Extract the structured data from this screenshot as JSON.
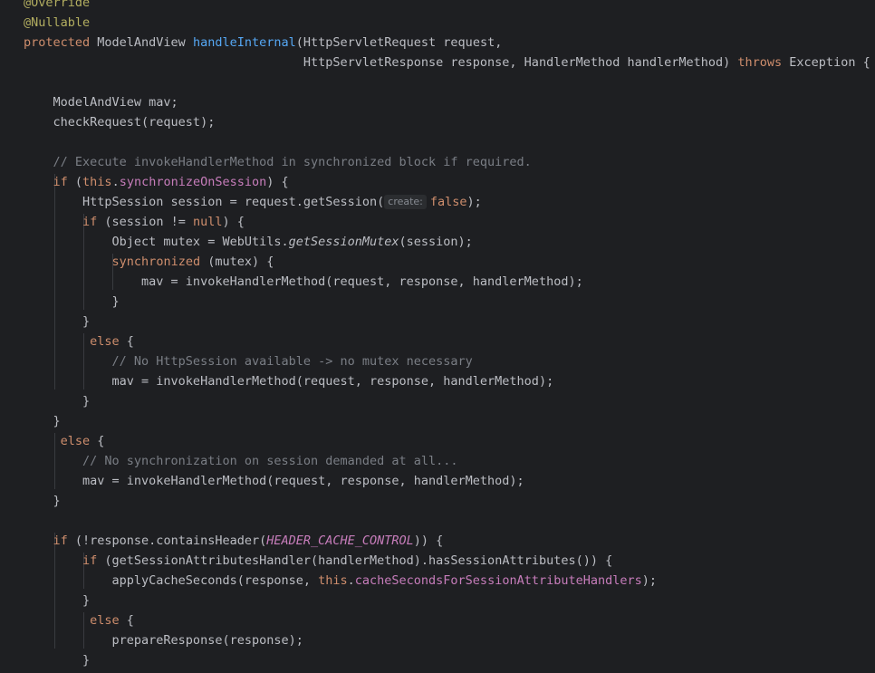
{
  "editor": {
    "lines": [
      [
        {
          "t": "@Override",
          "c": "ann"
        }
      ],
      [
        {
          "t": "@Nullable",
          "c": "ann"
        }
      ],
      [
        {
          "t": "protected ",
          "c": "kw"
        },
        {
          "t": "ModelAndView "
        },
        {
          "t": "handleInternal",
          "c": "fn"
        },
        {
          "t": "(HttpServletRequest request,"
        }
      ],
      [
        {
          "t": "                                      HttpServletResponse response, HandlerMethod handlerMethod) "
        },
        {
          "t": "throws ",
          "c": "kw"
        },
        {
          "t": "Exception {"
        }
      ],
      [],
      [
        {
          "t": "    ModelAndView mav;"
        }
      ],
      [
        {
          "t": "    checkRequest(request);"
        }
      ],
      [],
      [
        {
          "t": "    // Execute invokeHandlerMethod in synchronized block if required.",
          "c": "cm"
        }
      ],
      [
        {
          "t": "    "
        },
        {
          "t": "if ",
          "c": "kw"
        },
        {
          "t": "("
        },
        {
          "t": "this",
          "c": "kw"
        },
        {
          "t": "."
        },
        {
          "t": "synchronizeOnSession",
          "c": "fld"
        },
        {
          "t": ") {"
        }
      ],
      [
        {
          "t": "        HttpSession session = request.getSession("
        },
        {
          "t": "create:",
          "c": "hint"
        },
        {
          "t": "false",
          "c": "kw"
        },
        {
          "t": ");"
        }
      ],
      [
        {
          "t": "        "
        },
        {
          "t": "if ",
          "c": "kw"
        },
        {
          "t": "(session != "
        },
        {
          "t": "null",
          "c": "kw"
        },
        {
          "t": ") {"
        }
      ],
      [
        {
          "t": "            Object mutex = WebUtils."
        },
        {
          "t": "getSessionMutex",
          "c": "it"
        },
        {
          "t": "(session);"
        }
      ],
      [
        {
          "t": "            "
        },
        {
          "t": "synchronized ",
          "c": "kw"
        },
        {
          "t": "(mutex) {"
        }
      ],
      [
        {
          "t": "                mav = invokeHandlerMethod(request, response, handlerMethod);"
        }
      ],
      [
        {
          "t": "            }"
        }
      ],
      [
        {
          "t": "        }"
        }
      ],
      [
        {
          "t": "         "
        },
        {
          "t": "else ",
          "c": "kw"
        },
        {
          "t": "{"
        }
      ],
      [
        {
          "t": "            // No HttpSession available -> no mutex necessary",
          "c": "cm"
        }
      ],
      [
        {
          "t": "            mav = invokeHandlerMethod(request, response, handlerMethod);"
        }
      ],
      [
        {
          "t": "        }"
        }
      ],
      [
        {
          "t": "    }"
        }
      ],
      [
        {
          "t": "     "
        },
        {
          "t": "else ",
          "c": "kw"
        },
        {
          "t": "{"
        }
      ],
      [
        {
          "t": "        // No synchronization on session demanded at all...",
          "c": "cm"
        }
      ],
      [
        {
          "t": "        mav = invokeHandlerMethod(request, response, handlerMethod);"
        }
      ],
      [
        {
          "t": "    }"
        }
      ],
      [],
      [
        {
          "t": "    "
        },
        {
          "t": "if ",
          "c": "kw"
        },
        {
          "t": "(!response.containsHeader("
        },
        {
          "t": "HEADER_CACHE_CONTROL",
          "c": "cst"
        },
        {
          "t": ")) {"
        }
      ],
      [
        {
          "t": "        "
        },
        {
          "t": "if ",
          "c": "kw"
        },
        {
          "t": "(getSessionAttributesHandler(handlerMethod).hasSessionAttributes()) {"
        }
      ],
      [
        {
          "t": "            applyCacheSeconds(response, "
        },
        {
          "t": "this",
          "c": "kw"
        },
        {
          "t": "."
        },
        {
          "t": "cacheSecondsForSessionAttributeHandlers",
          "c": "fld"
        },
        {
          "t": ");"
        }
      ],
      [
        {
          "t": "        }"
        }
      ],
      [
        {
          "t": "         "
        },
        {
          "t": "else ",
          "c": "kw"
        },
        {
          "t": "{"
        }
      ],
      [
        {
          "t": "            prepareResponse(response);"
        }
      ],
      [
        {
          "t": "        }"
        }
      ]
    ]
  }
}
